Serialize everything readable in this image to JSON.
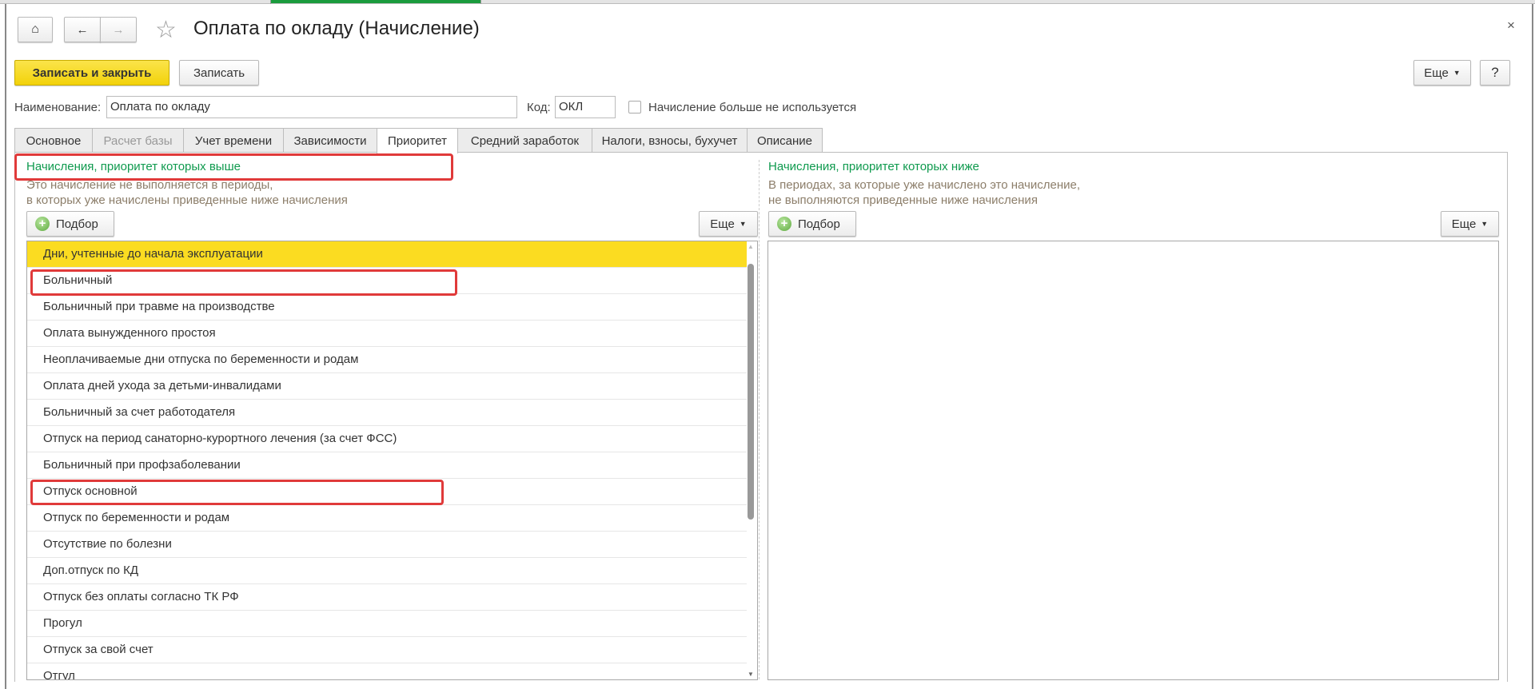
{
  "window": {
    "title": "Оплата по окладу (Начисление)",
    "close": "×"
  },
  "nav": {
    "home_icon": "home-icon",
    "back_icon": "arrow-left-icon",
    "forward_icon": "arrow-right-icon",
    "favorite_icon": "star-icon"
  },
  "toolbar": {
    "save_close": "Записать и закрыть",
    "save": "Записать",
    "more": "Еще",
    "help": "?"
  },
  "form": {
    "name_label": "Наименование:",
    "name_value": "Оплата по окладу",
    "code_label": "Код:",
    "code_value": "ОКЛ",
    "unused_label": "Начисление больше не используется",
    "unused_checked": false
  },
  "tabs": [
    {
      "label": "Основное"
    },
    {
      "label": "Расчет базы",
      "disabled": true
    },
    {
      "label": "Учет времени"
    },
    {
      "label": "Зависимости"
    },
    {
      "label": "Приоритет",
      "active": true
    },
    {
      "label": "Средний заработок"
    },
    {
      "label": "Налоги, взносы, бухучет"
    },
    {
      "label": "Описание"
    }
  ],
  "left": {
    "header": "Начисления, приоритет которых выше",
    "desc1": "Это начисление не выполняется в периоды,",
    "desc2": "в которых уже начислены приведенные ниже начисления",
    "pick": "Подбор",
    "more": "Еще",
    "items": [
      "Дни, учтенные до начала эксплуатации",
      "Больничный",
      "Больничный при травме на производстве",
      "Оплата вынужденного простоя",
      "Неоплачиваемые дни отпуска по беременности и родам",
      "Оплата дней ухода за детьми-инвалидами",
      "Больничный за счет работодателя",
      "Отпуск на период санаторно-курортного лечения (за счет ФСС)",
      "Больничный при профзаболевании",
      "Отпуск основной",
      "Отпуск по беременности и родам",
      "Отсутствие по болезни",
      "Доп.отпуск по КД",
      "Отпуск без оплаты согласно ТК РФ",
      "Прогул",
      "Отпуск за свой счет",
      "Отгул"
    ]
  },
  "right": {
    "header": "Начисления, приоритет которых ниже",
    "desc1": "В периодах, за которые уже начислено это начисление,",
    "desc2": "не выполняются приведенные ниже начисления",
    "pick": "Подбор",
    "more": "Еще",
    "items": []
  },
  "colors": {
    "accent": "#fbdc21",
    "header_green": "#0f9a4e",
    "highlight_red": "#e03a3a"
  }
}
